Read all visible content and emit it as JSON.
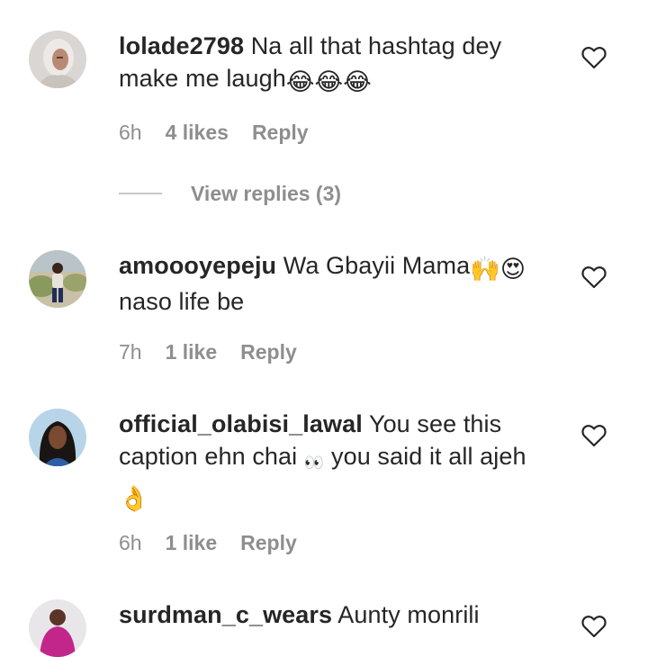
{
  "comments": [
    {
      "username": "lolade2798",
      "text": "Na all that hashtag dey make me laugh",
      "emoji": "😂😂😂",
      "time": "6h",
      "likes": "4 likes",
      "reply": "Reply"
    },
    {
      "username": "amoooyepeju",
      "text": "Wa Gbayii Mama",
      "emoji": "🙌😍",
      "text2": "naso life be",
      "time": "7h",
      "likes": "1 like",
      "reply": "Reply"
    },
    {
      "username": "official_olabisi_lawal",
      "text": "You see this caption ehn chai",
      "emoji_mid": "👀",
      "text2": "you said it all ajeh",
      "emoji": "👌",
      "time": "6h",
      "likes": "1 like",
      "reply": "Reply"
    },
    {
      "username": "surdman_c_wears",
      "text": "Aunty monrili"
    }
  ],
  "view_replies": "View replies (3)",
  "icons": {
    "like": "heart-outline-icon"
  },
  "colors": {
    "text": "#262626",
    "secondary": "#8e8e8e"
  }
}
